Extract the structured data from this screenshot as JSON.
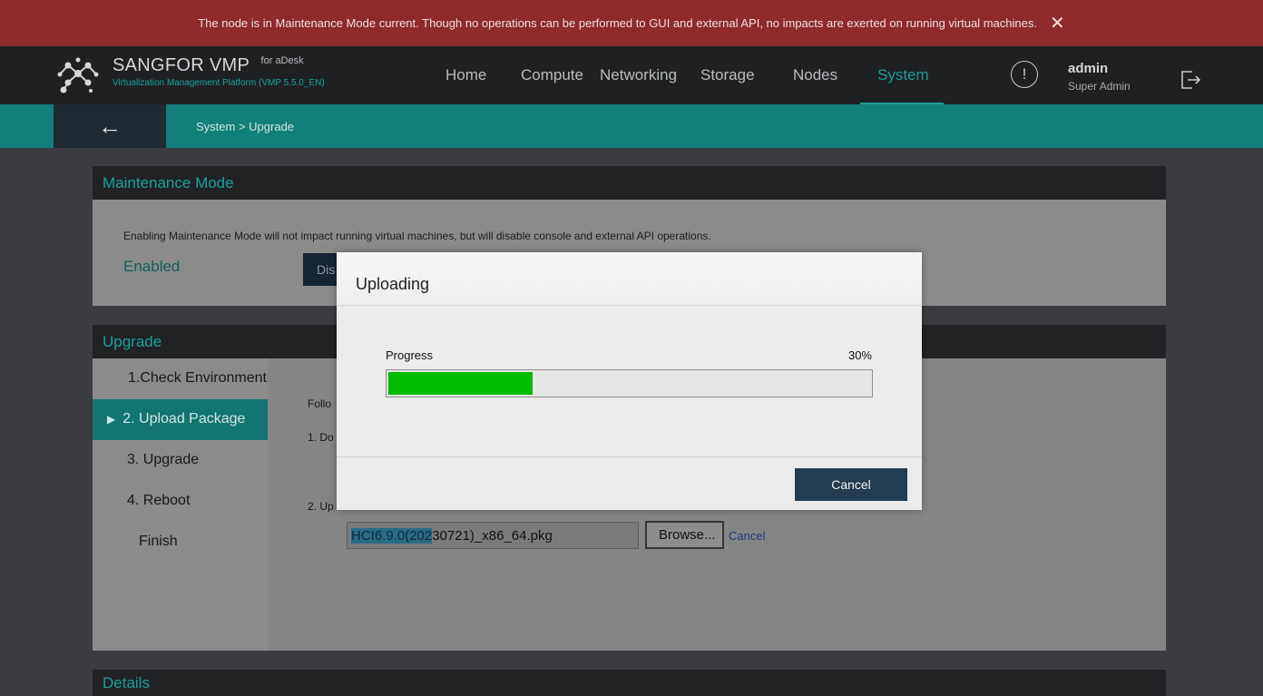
{
  "alert": {
    "message": "The node is in Maintenance Mode current. Though no operations can be performed to GUI and external API, no impacts are exerted on running virtual machines.",
    "close_icon": "close-icon"
  },
  "navbar": {
    "brand_name": "SANGFOR VMP",
    "brand_for": "for aDesk",
    "brand_subtitle": "Virtualization Management Platform (VMP 5.5.0_EN)",
    "items": [
      {
        "label": "Home"
      },
      {
        "label": "Compute"
      },
      {
        "label": "Networking"
      },
      {
        "label": "Storage"
      },
      {
        "label": "Nodes"
      },
      {
        "label": "System"
      }
    ],
    "active_item": "System",
    "alert_icon": "!",
    "user_name": "admin",
    "user_role": "Super Admin"
  },
  "breadcrumb": {
    "back_icon": "←",
    "path": "System > Upgrade"
  },
  "maintenance": {
    "title": "Maintenance Mode",
    "description": "Enabling Maintenance Mode will not impact running virtual machines, but will disable console and external API operations.",
    "status": "Enabled",
    "button_label_visible": "Dis"
  },
  "upgrade": {
    "title": "Upgrade",
    "steps": [
      {
        "label": "1.Check Environment"
      },
      {
        "label": "2. Upload Package"
      },
      {
        "label": "3. Upgrade"
      },
      {
        "label": "4. Reboot"
      },
      {
        "label": "Finish"
      }
    ],
    "active_step_arrow": "▶",
    "content_fragments": {
      "intro": "Follo",
      "step1": "1. Do",
      "step2": "2. Up"
    },
    "file_name_selected": "HCI6.9.0(202",
    "file_name_rest": "30721)_x86_64.pkg",
    "browse_label": "Browse...",
    "cancel_label": "Cancel"
  },
  "details": {
    "title": "Details"
  },
  "modal": {
    "title": "Uploading",
    "progress_label": "Progress",
    "progress_text": "30%",
    "progress_value": 0.3,
    "cancel_label": "Cancel"
  },
  "colors": {
    "accent": "#1b9d95",
    "alert_bg": "#8e2a2a",
    "progress_fill": "#00bb00",
    "primary_button": "#223d52"
  }
}
